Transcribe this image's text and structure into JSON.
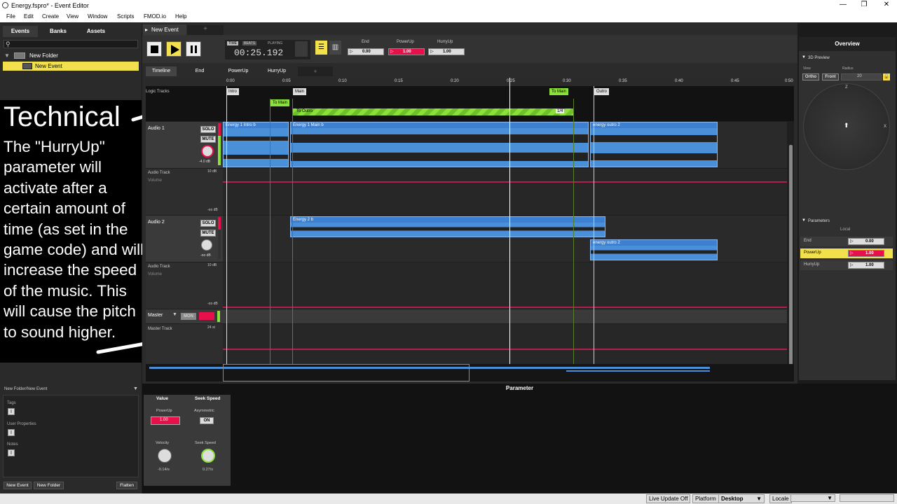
{
  "window": {
    "title": "Energy.fspro* - Event Editor",
    "minimize": "—",
    "restore": "❐",
    "close": "✕"
  },
  "menu": [
    "File",
    "Edit",
    "Create",
    "View",
    "Window",
    "Scripts",
    "FMOD.io",
    "Help"
  ],
  "left_tabs": [
    "Events",
    "Banks",
    "Assets"
  ],
  "browser": {
    "folder": "New Folder",
    "event": "New Event"
  },
  "overlay": {
    "title": "Technical",
    "body": "The \"HurryUp\" parameter will activate after a certain amount of time (as set in the game code) and will increase the speed of the music. This will cause the pitch to sound higher."
  },
  "lower_left": {
    "path": "New Folder/New Event",
    "sections": [
      "Tags",
      "User Properties",
      "Notes"
    ],
    "buttons": {
      "new_event": "New Event",
      "new_folder": "New Folder",
      "flatten": "Flatten"
    }
  },
  "event_tab": {
    "label": "New Event",
    "add": "+"
  },
  "transport": {
    "time_mode": "TIME",
    "beats_mode": "BEATS",
    "state": "PLAYING",
    "time": "00:25.192"
  },
  "params_top": [
    {
      "name": "End",
      "value": "0.00",
      "active": false
    },
    {
      "name": "PowerUp",
      "value": "1.00",
      "active": true
    },
    {
      "name": "HurryUp",
      "value": "1.00",
      "active": false
    }
  ],
  "sheet_tabs": [
    "Timeline",
    "End",
    "PowerUp",
    "HurryUp",
    "+"
  ],
  "ruler": [
    "0:00",
    "0:05",
    "0:10",
    "0:15",
    "0:20",
    "0:25",
    "0:30",
    "0:35",
    "0:40",
    "0:45",
    "0:50"
  ],
  "logic_label": "Logic Tracks",
  "markers": {
    "intro": "Intro",
    "main": "Main",
    "outro": "Outro",
    "to_main_1": "To Main",
    "to_main_2": "To Main",
    "to_outro": "To Outro",
    "fraction": "1/4"
  },
  "tracks": {
    "audio1": {
      "name": "Audio 1",
      "solo": "SOLO",
      "mute": "MUTE",
      "db": "-4.0 dB",
      "auto": "Audio Track",
      "auto_sub": "Volume",
      "top_db": "10 dB",
      "bottom_db": "-oo dB"
    },
    "audio2": {
      "name": "Audio 2",
      "solo": "SOLO",
      "mute": "MUTE",
      "db": "-oo dB",
      "auto": "Audio Track",
      "auto_sub": "Volume",
      "top_db": "10 dB",
      "bottom_db": "-oo dB"
    },
    "master": {
      "name": "Master",
      "mon": "MON",
      "auto": "Master Track",
      "top_db": "24 st"
    }
  },
  "instruments": {
    "intro": "Energy 1 Intro b",
    "main1": "Energy 1 Main b",
    "outro1": "energy outro 2",
    "main2": "Energy 2 b",
    "outro2": "energy outro 2"
  },
  "overview": {
    "title": "Overview",
    "preview": "3D Preview",
    "view": "View",
    "ortho": "Ortho",
    "front": "Front",
    "radius": "Radius",
    "radius_val": "20",
    "z": "Z",
    "x": "X",
    "parameters": "Parameters",
    "local": "Local",
    "params": [
      {
        "name": "End",
        "value": "0.00",
        "active": false
      },
      {
        "name": "PowerUp",
        "value": "1.00",
        "active": true
      },
      {
        "name": "HurryUp",
        "value": "1.00",
        "active": false
      }
    ]
  },
  "deck": {
    "title": "Parameter",
    "value_tab": "Value",
    "seek_tab": "Seek Speed",
    "param": "PowerUp",
    "param_val": "1.00",
    "asym": "Asymmetric",
    "asym_val": "ON",
    "velocity": "Velocity",
    "velocity_val": "-0.14/s",
    "seek": "Seek Speed",
    "seek_val": "0.27/s"
  },
  "status": {
    "live": "Live Update Off",
    "platform": "Platform",
    "platform_val": "Desktop",
    "locale": "Locale"
  },
  "colors": {
    "accent": "#f2e14d",
    "power": "#e8104a",
    "green": "#8be03a",
    "clip": "#4a90d9",
    "automation": "#b0204c"
  }
}
